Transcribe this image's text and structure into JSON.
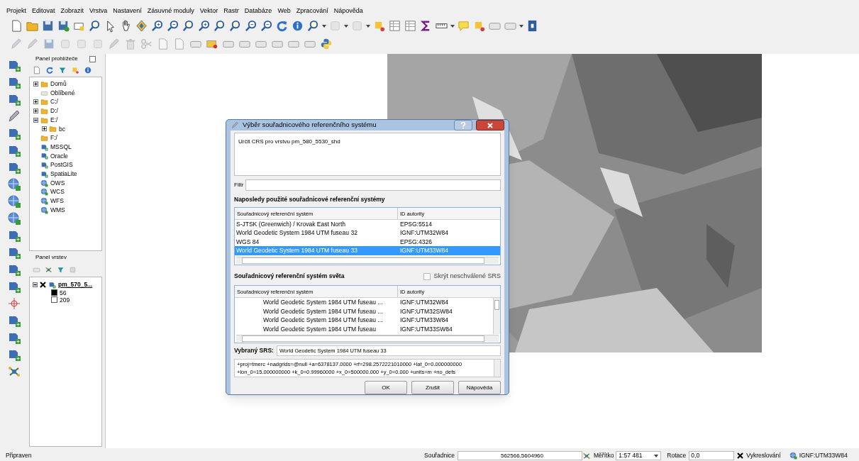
{
  "menu": [
    "Projekt",
    "Editovat",
    "Zobrazit",
    "Vrstva",
    "Nastavení",
    "Zásuvné moduly",
    "Vektor",
    "Rastr",
    "Databáze",
    "Web",
    "Zpracování",
    "Nápověda"
  ],
  "browser_panel": {
    "title": "Panel prohlížeče",
    "tree": [
      {
        "label": "Domů",
        "kind": "folder",
        "expanded": false
      },
      {
        "label": "Oblíbené",
        "kind": "star"
      },
      {
        "label": "C:/",
        "kind": "folder",
        "expanded": false
      },
      {
        "label": "D:/",
        "kind": "folder",
        "expanded": false
      },
      {
        "label": "E:/",
        "kind": "folder",
        "expanded": true,
        "children": [
          {
            "label": "bc",
            "kind": "folder",
            "expanded": false
          }
        ]
      },
      {
        "label": "F:/",
        "kind": "folder"
      },
      {
        "label": "MSSQL",
        "kind": "db"
      },
      {
        "label": "Oracle",
        "kind": "db"
      },
      {
        "label": "PostGIS",
        "kind": "db"
      },
      {
        "label": "SpatiaLite",
        "kind": "db"
      },
      {
        "label": "OWS",
        "kind": "globe"
      },
      {
        "label": "WCS",
        "kind": "globe"
      },
      {
        "label": "WFS",
        "kind": "globe"
      },
      {
        "label": "WMS",
        "kind": "globe"
      }
    ]
  },
  "layers_panel": {
    "title": "Panel vrstev",
    "layers": [
      {
        "name": "pm_570_5...",
        "visible": true,
        "legend": [
          {
            "label": "56",
            "color": "#000000"
          },
          {
            "label": "209",
            "color": "#ffffff"
          }
        ]
      }
    ]
  },
  "dialog": {
    "title": "Výběr souřadnicového referenčního systému",
    "description": "Určit CRS pro vrstvu pm_580_5530_shd",
    "filter": {
      "label": "Filtr"
    },
    "recent": {
      "title": "Naposledy použité souřadnicové referenční systémy",
      "columns": [
        "Souřadnicový referenční systém",
        "ID autority"
      ],
      "rows": [
        {
          "name": "S-JTSK (Greenwich) / Krovak East North",
          "id": "EPSG:5514",
          "selected": false
        },
        {
          "name": "World Geodetic System 1984 UTM fuseau 32",
          "id": "IGNF:UTM32W84",
          "selected": false
        },
        {
          "name": "WGS 84",
          "id": "EPSG:4326",
          "selected": false
        },
        {
          "name": "World Geodetic System 1984 UTM fuseau 33",
          "id": "IGNF:UTM33W84",
          "selected": true
        }
      ]
    },
    "world": {
      "title": "Souřadnicový referenční systém světa",
      "hide_deprecated": {
        "label": "Skrýt neschválené SRS",
        "checked": false
      },
      "columns": [
        "Souřadnicový referenční systém",
        "ID autority"
      ],
      "rows": [
        {
          "name": "World Geodetic System 1984 UTM fuseau ...",
          "id": "IGNF:UTM32W84"
        },
        {
          "name": "World Geodetic System 1984 UTM fuseau ...",
          "id": "IGNF:UTM32SW84"
        },
        {
          "name": "World Geodetic System 1984 UTM fuseau ...",
          "id": "IGNF:UTM33W84"
        },
        {
          "name": "World Geodetic System 1984 UTM fuseau",
          "id": "IGNF:UTM33SW84"
        }
      ]
    },
    "selected_srs": {
      "label": "Vybraný SRS:",
      "value": "World Geodetic System 1984 UTM fuseau 33"
    },
    "proj": "+proj=tmerc +nadgrids=@null +a=6378137.0000 +rf=298.2572221010000 +lat_0=0.000000000 +lon_0=15.000000000 +k_0=0.99960000 +x_0=500000.000 +y_0=0.000 +units=m +no_defs",
    "buttons": [
      "OK",
      "Zrušit",
      "Nápověda"
    ]
  },
  "status_bar": {
    "message": "Připraven",
    "coords": {
      "label": "Souřadnice",
      "value": "562566,5604960"
    },
    "scale": {
      "label": "Měřítko",
      "value": "1:57 481"
    },
    "rotation": {
      "label": "Rotace",
      "value": "0,0"
    },
    "render": {
      "label": "Vykreslování",
      "checked": true
    },
    "crs": "IGNF:UTM33W84"
  }
}
